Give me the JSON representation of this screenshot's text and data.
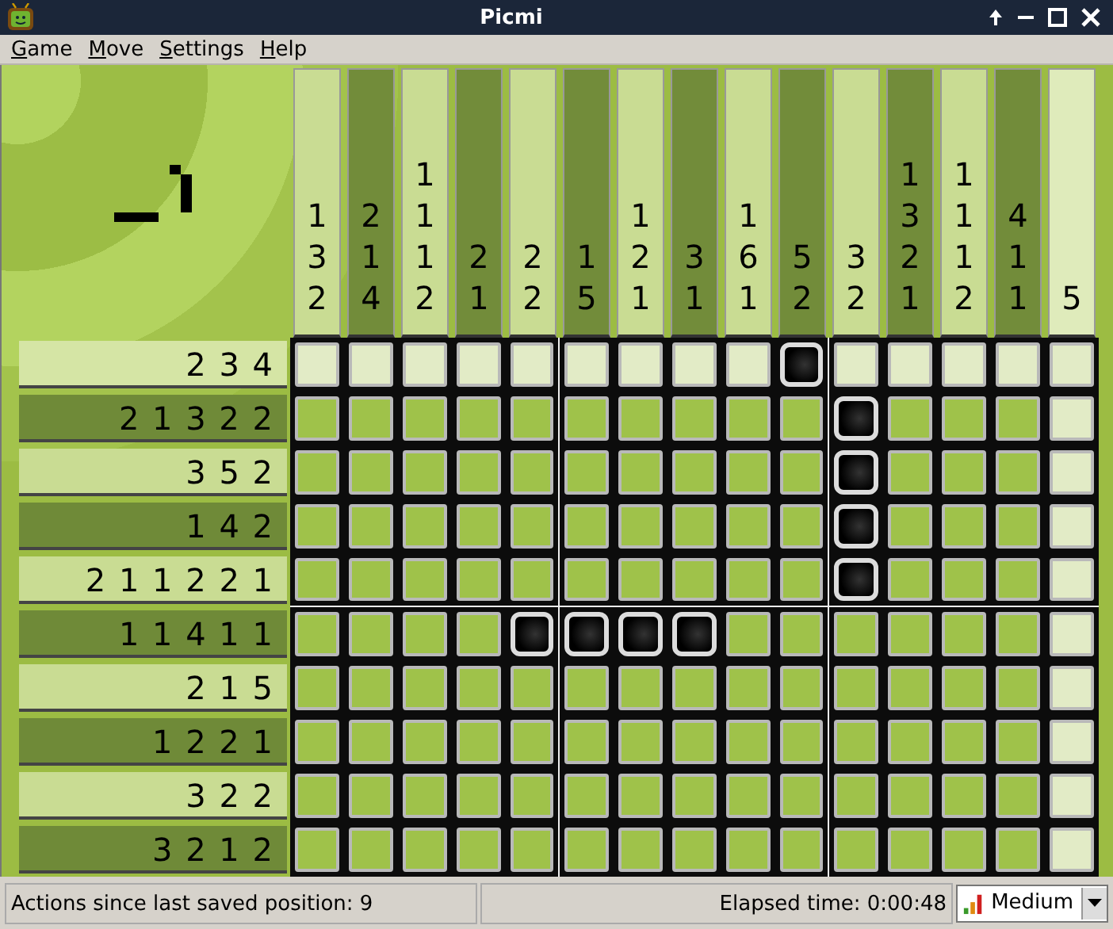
{
  "window": {
    "title": "Picmi"
  },
  "menu": [
    "Game",
    "Move",
    "Settings",
    "Help"
  ],
  "board": {
    "columns": [
      {
        "clue": [
          "1",
          "3",
          "2"
        ],
        "highlighted": false
      },
      {
        "clue": [
          "2",
          "1",
          "4"
        ],
        "highlighted": false
      },
      {
        "clue": [
          "1",
          "1",
          "1",
          "2"
        ],
        "highlighted": false
      },
      {
        "clue": [
          "2",
          "1"
        ],
        "highlighted": false
      },
      {
        "clue": [
          "2",
          "2"
        ],
        "highlighted": false
      },
      {
        "clue": [
          "1",
          "5"
        ],
        "highlighted": false
      },
      {
        "clue": [
          "1",
          "2",
          "1"
        ],
        "highlighted": false
      },
      {
        "clue": [
          "3",
          "1"
        ],
        "highlighted": false
      },
      {
        "clue": [
          "1",
          "6",
          "1"
        ],
        "highlighted": false
      },
      {
        "clue": [
          "5",
          "2"
        ],
        "highlighted": false
      },
      {
        "clue": [
          "3",
          "2"
        ],
        "highlighted": false
      },
      {
        "clue": [
          "1",
          "3",
          "2",
          "1"
        ],
        "highlighted": false
      },
      {
        "clue": [
          "1",
          "1",
          "1",
          "2"
        ],
        "highlighted": false
      },
      {
        "clue": [
          "4",
          "1",
          "1"
        ],
        "highlighted": false
      },
      {
        "clue": [
          "5"
        ],
        "highlighted": true
      }
    ],
    "rows": [
      {
        "clue": "2 3 4",
        "highlighted": true,
        "filled": [
          false,
          false,
          false,
          false,
          false,
          false,
          false,
          false,
          false,
          true,
          false,
          false,
          false,
          false,
          false
        ]
      },
      {
        "clue": "2 1 3 2 2",
        "highlighted": false,
        "filled": [
          false,
          false,
          false,
          false,
          false,
          false,
          false,
          false,
          false,
          false,
          true,
          false,
          false,
          false,
          false
        ]
      },
      {
        "clue": "3 5 2",
        "highlighted": false,
        "filled": [
          false,
          false,
          false,
          false,
          false,
          false,
          false,
          false,
          false,
          false,
          true,
          false,
          false,
          false,
          false
        ]
      },
      {
        "clue": "1 4 2",
        "highlighted": false,
        "filled": [
          false,
          false,
          false,
          false,
          false,
          false,
          false,
          false,
          false,
          false,
          true,
          false,
          false,
          false,
          false
        ]
      },
      {
        "clue": "2 1 1 2 2 1",
        "highlighted": false,
        "filled": [
          false,
          false,
          false,
          false,
          false,
          false,
          false,
          false,
          false,
          false,
          true,
          false,
          false,
          false,
          false
        ]
      },
      {
        "clue": "1 1 4 1 1",
        "highlighted": false,
        "filled": [
          false,
          false,
          false,
          false,
          true,
          true,
          true,
          true,
          false,
          false,
          false,
          false,
          false,
          false,
          false
        ]
      },
      {
        "clue": "2 1 5",
        "highlighted": false,
        "filled": [
          false,
          false,
          false,
          false,
          false,
          false,
          false,
          false,
          false,
          false,
          false,
          false,
          false,
          false,
          false
        ]
      },
      {
        "clue": "1 2 2 1",
        "highlighted": false,
        "filled": [
          false,
          false,
          false,
          false,
          false,
          false,
          false,
          false,
          false,
          false,
          false,
          false,
          false,
          false,
          false
        ]
      },
      {
        "clue": "3 2 2",
        "highlighted": false,
        "filled": [
          false,
          false,
          false,
          false,
          false,
          false,
          false,
          false,
          false,
          false,
          false,
          false,
          false,
          false,
          false
        ]
      },
      {
        "clue": "3 2 1 2",
        "highlighted": false,
        "filled": [
          false,
          false,
          false,
          false,
          false,
          false,
          false,
          false,
          false,
          false,
          false,
          false,
          false,
          false,
          false
        ]
      }
    ]
  },
  "status_bar": {
    "actions": "Actions since last saved position: 9",
    "elapsed": "Elapsed time: 0:00:48",
    "difficulty": "Medium"
  }
}
